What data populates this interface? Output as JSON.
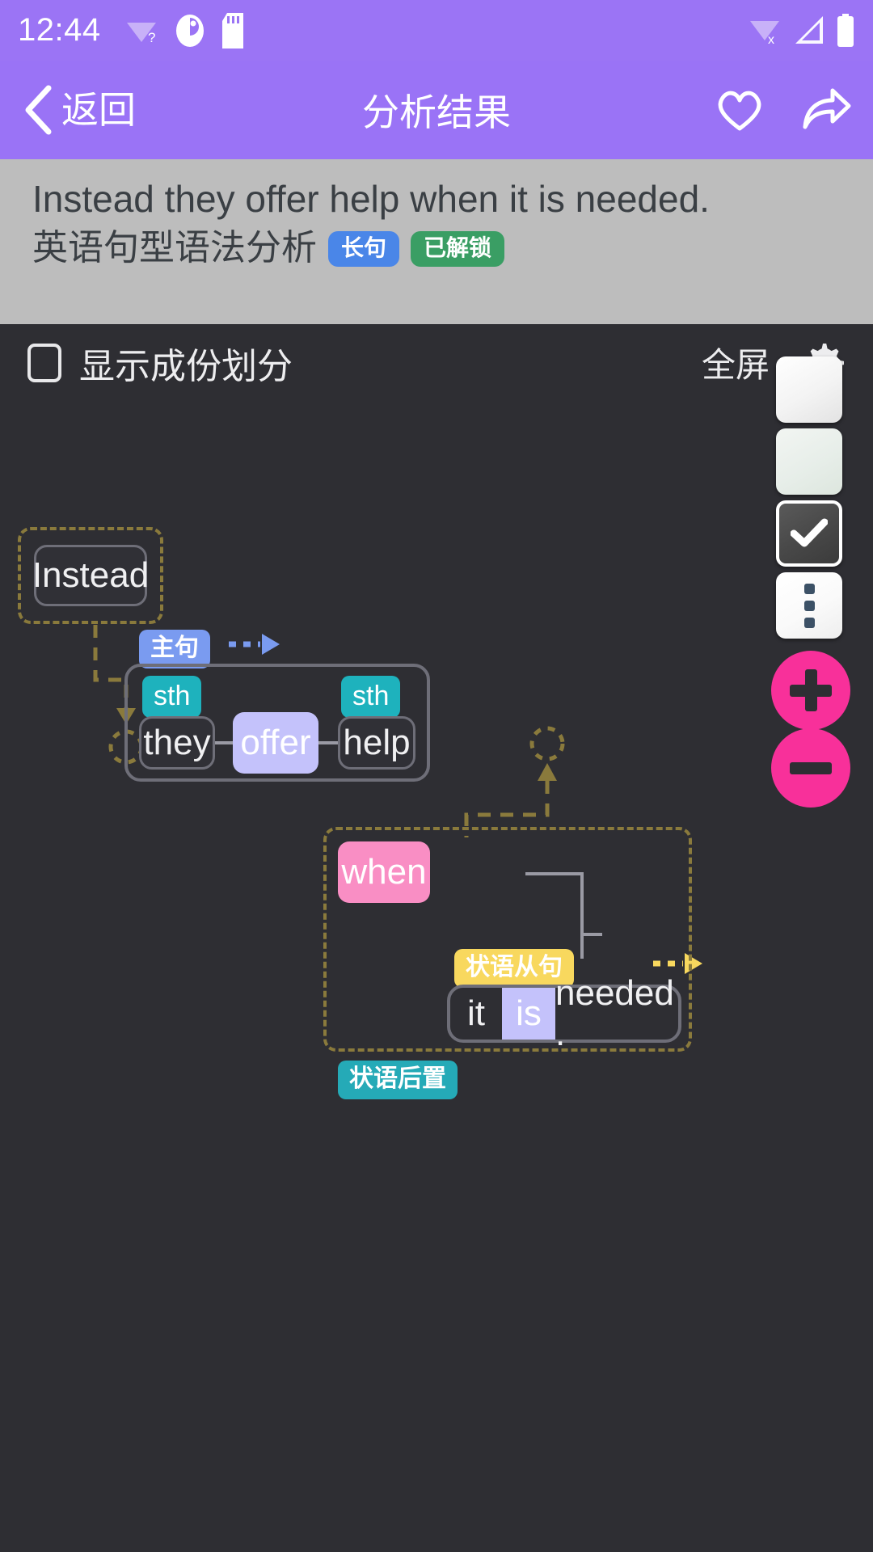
{
  "statusbar": {
    "time": "12:44",
    "icons_left": [
      "wifi-question-icon",
      "app-badge-icon",
      "sd-card-icon"
    ],
    "icons_right": [
      "wifi-off-icon",
      "signal-icon",
      "battery-icon"
    ]
  },
  "appbar": {
    "back_label": "返回",
    "back_icon": "chevron-left-icon",
    "title": "分析结果",
    "favorite_icon": "heart-icon",
    "share_icon": "share-icon"
  },
  "sentence_header": {
    "sentence_en": "Instead they offer help when it is needed.",
    "sentence_cn": "英语句型语法分析",
    "badges": [
      {
        "label": "长句",
        "color": "#4a86e8"
      },
      {
        "label": "已解锁",
        "color": "#3a9e64"
      }
    ]
  },
  "canvas_toolbar": {
    "checkbox_label": "显示成份划分",
    "checkbox_checked": false,
    "fullscreen_label": "全屏",
    "settings_icon": "gear-icon"
  },
  "side_buttons": [
    {
      "name": "layout-blank-button",
      "icon": "blank-icon"
    },
    {
      "name": "layout-blank2-button",
      "icon": "blank-icon"
    },
    {
      "name": "confirm-check-button",
      "icon": "check-icon"
    },
    {
      "name": "more-options-button",
      "icon": "dots-vertical-icon"
    }
  ],
  "zoom_buttons": [
    {
      "name": "zoom-in-button",
      "icon": "plus-icon",
      "color": "#f8309a"
    },
    {
      "name": "zoom-out-button",
      "icon": "minus-icon",
      "color": "#f8309a"
    }
  ],
  "diagram": {
    "nodes": {
      "instead": "Instead",
      "they": "they",
      "offer": "offer",
      "help": "help",
      "when": "when",
      "it": "it",
      "is": "is",
      "needed": "needed ."
    },
    "tags": {
      "main_clause": "主句",
      "sth_subject": "sth",
      "sth_object": "sth",
      "adverbial_clause": "状语从句",
      "adverbial_postposed": "状语后置"
    },
    "colors": {
      "dashed_group": "#8a7a3c",
      "node_border": "#6e6e78",
      "node_bg": "#303036",
      "verb_highlight": "#c4c2fb",
      "conjunction_highlight": "#f98ec4",
      "sth_tag": "#1eb2bd",
      "main_clause_tag": "#7a9bf0",
      "adverbial_tag": "#f8d85e",
      "postposed_tag": "#25aab7"
    }
  }
}
